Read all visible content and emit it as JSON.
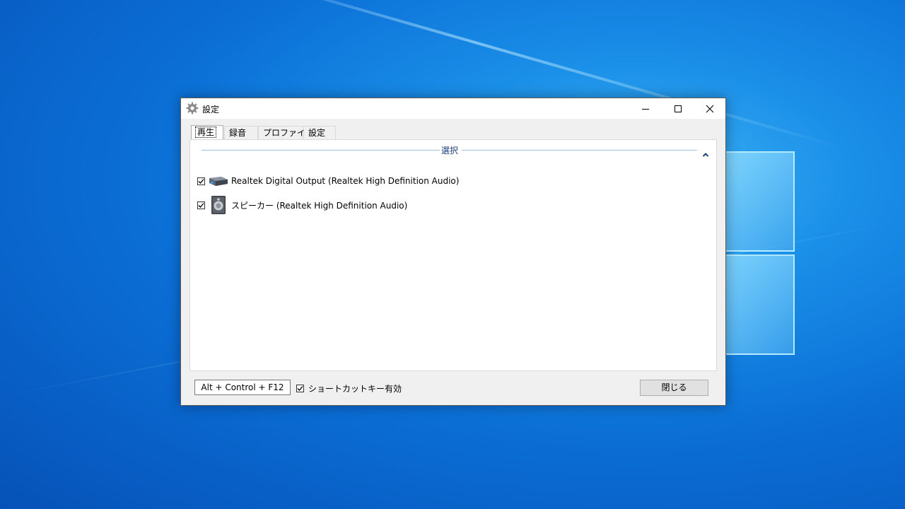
{
  "window": {
    "title": "設定",
    "controls": {
      "minimize": "minimize-icon",
      "maximize": "maximize-icon",
      "close": "close-icon"
    }
  },
  "tabs": [
    {
      "label": "再生",
      "active": true
    },
    {
      "label": "録音",
      "active": false
    },
    {
      "label": "プロファイル",
      "active": false
    },
    {
      "label": "設定",
      "active": false
    }
  ],
  "group": {
    "title": "選択",
    "devices": [
      {
        "label": "Realtek Digital Output (Realtek High Definition Audio)",
        "checked": true,
        "icon": "digital-output-icon"
      },
      {
        "label": "スピーカー (Realtek High Definition Audio)",
        "checked": true,
        "icon": "speaker-icon"
      }
    ]
  },
  "footer": {
    "hotkey": "Alt + Control + F12",
    "shortcut_label": "ショートカットキー有効",
    "shortcut_checked": true,
    "close_label": "閉じる"
  }
}
